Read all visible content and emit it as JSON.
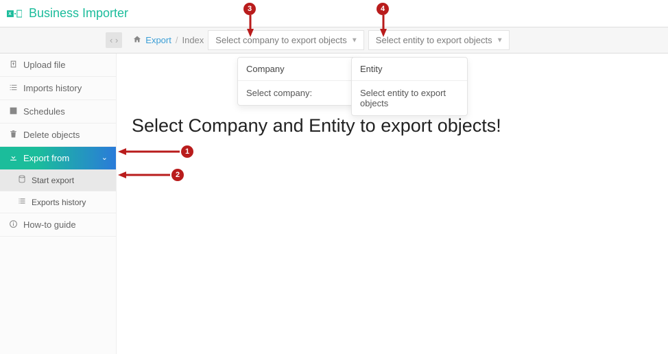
{
  "brand": {
    "name": "Business Importer"
  },
  "breadcrumb": {
    "root": "Export",
    "current": "Index"
  },
  "selectors": {
    "company_placeholder": "Select company to export objects",
    "entity_placeholder": "Select entity to export objects"
  },
  "dropdowns": {
    "company": {
      "title": "Company",
      "body": "Select company:"
    },
    "entity": {
      "title": "Entity",
      "body": "Select entity to export objects"
    }
  },
  "sidebar": {
    "upload": "Upload file",
    "imports_history": "Imports history",
    "schedules": "Schedules",
    "delete_objects": "Delete objects",
    "export_from": "Export from",
    "start_export": "Start export",
    "exports_history": "Exports history",
    "howto": "How-to guide"
  },
  "main": {
    "title": "Select Company and Entity to export objects!"
  },
  "annotations": {
    "n1": "1",
    "n2": "2",
    "n3": "3",
    "n4": "4"
  }
}
